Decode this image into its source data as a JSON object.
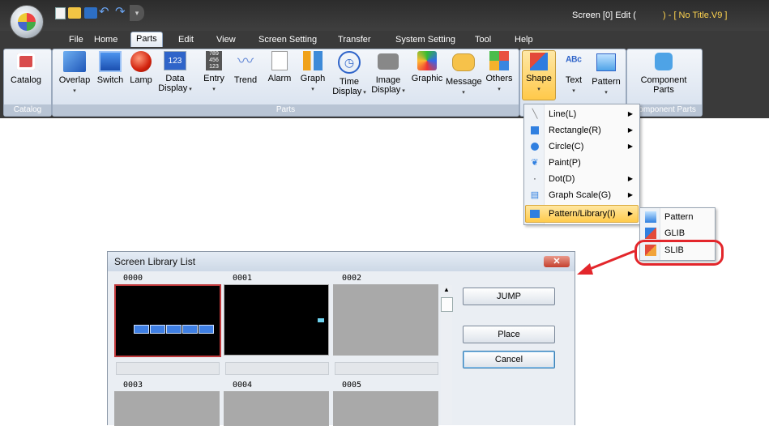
{
  "window": {
    "title": "Screen [0] Edit (",
    "title_suffix": ")  - [ No Title.V9 ]"
  },
  "tabs": [
    "File",
    "Home",
    "Parts",
    "Edit",
    "View",
    "Screen Setting",
    "Transfer",
    "System Setting",
    "Tool",
    "Help"
  ],
  "active_tab": "Parts",
  "ribbon": {
    "groups": {
      "catalog": "Catalog",
      "parts": "Parts",
      "component_parts": "Component Parts"
    },
    "buttons": {
      "catalog": "Catalog",
      "overlap": "Overlap",
      "switch": "Switch",
      "lamp": "Lamp",
      "data_display_1": "Data",
      "data_display_2": "Display",
      "entry": "Entry",
      "trend": "Trend",
      "alarm": "Alarm",
      "graph": "Graph",
      "time_display_1": "Time",
      "time_display_2": "Display",
      "image_display_1": "Image",
      "image_display_2": "Display",
      "graphic": "Graphic",
      "message": "Message",
      "others": "Others",
      "shape": "Shape",
      "text": "Text",
      "pattern": "Pattern",
      "component_parts_1": "Component",
      "component_parts_2": "Parts"
    }
  },
  "shape_menu": [
    {
      "label": "Line(L)",
      "icon": "line-icon",
      "has_submenu": true
    },
    {
      "label": "Rectangle(R)",
      "icon": "rectangle-icon",
      "has_submenu": true
    },
    {
      "label": "Circle(C)",
      "icon": "circle-icon",
      "has_submenu": true
    },
    {
      "label": "Paint(P)",
      "icon": "paint-icon",
      "has_submenu": false
    },
    {
      "label": "Dot(D)",
      "icon": "dot-icon",
      "has_submenu": true
    },
    {
      "label": "Graph Scale(G)",
      "icon": "graph-scale-icon",
      "has_submenu": true
    },
    {
      "label": "Pattern/Library(I)",
      "icon": "pattern-library-icon",
      "has_submenu": true,
      "highlighted": true
    }
  ],
  "pattern_submenu": [
    "Pattern",
    "GLIB",
    "SLIB"
  ],
  "dialog": {
    "title": "Screen Library List",
    "close": "✕",
    "thumbnails": [
      "0000",
      "0001",
      "0002",
      "0003",
      "0004",
      "0005"
    ],
    "buttons": {
      "jump": "JUMP",
      "place": "Place",
      "cancel": "Cancel"
    }
  },
  "colors": {
    "accent_highlight": "#e3262b",
    "menu_hover": "#ffcb4c",
    "key_blue": "#3f7fe3"
  }
}
